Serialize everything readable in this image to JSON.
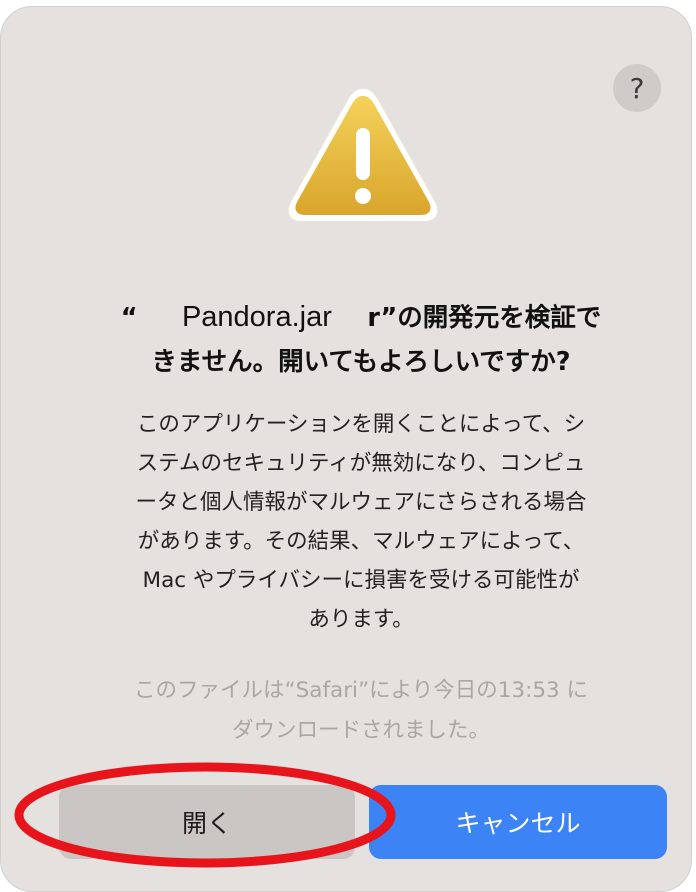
{
  "dialog": {
    "help_label": "?",
    "warning_icon": "warning-triangle-icon",
    "title": {
      "open_quote": "“",
      "file_name": "Pandora.jar",
      "rest_line1": "r”の開発元を検証で",
      "line2": "きません。開いてもよろしいですか?"
    },
    "message_lines": [
      "このアプリケーションを開くことによって、シ",
      "ステムのセキュリティが無効になり、コンピュ",
      "ータと個人情報がマルウェアにさらされる場合",
      "があります。その結果、マルウェアによって、",
      "Mac やプライバシーに損害を受ける可能性が",
      "あります。"
    ],
    "source_lines": [
      "このファイルは“Safari”により今日の13:53 に",
      "ダウンロードされました。"
    ],
    "buttons": {
      "open_label": "開く",
      "cancel_label": "キャンセル"
    },
    "colors": {
      "dialog_background": "#e5e1df",
      "cancel_button": "#3c83f5",
      "open_button": "#cac6c4",
      "annotation_ring": "#e8141b",
      "warning_fill": "#e2b437"
    }
  }
}
